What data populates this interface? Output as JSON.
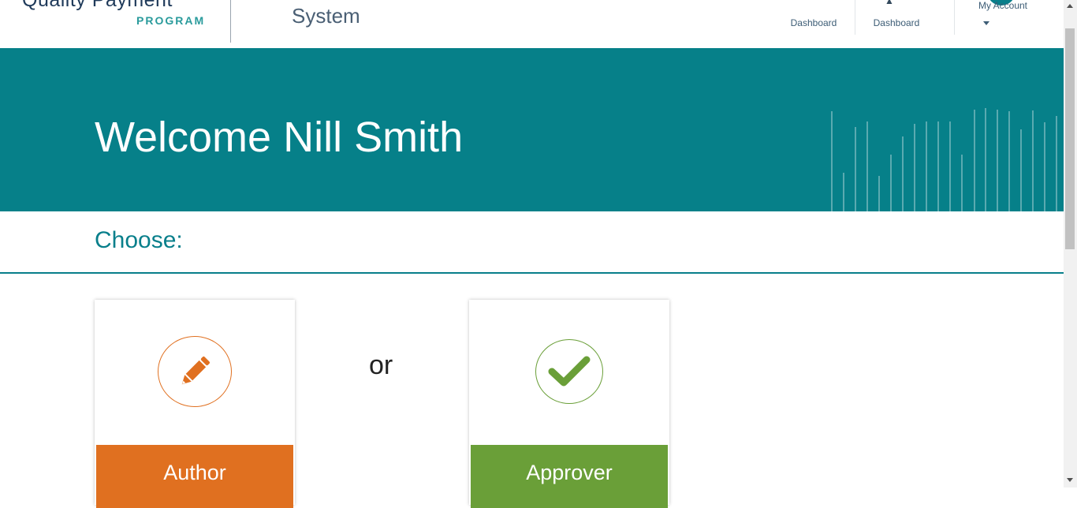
{
  "header": {
    "logo_line1": "Quality Payment",
    "logo_line2": "PROGRAM",
    "system_text": "System",
    "nav": [
      {
        "label": "Dashboard"
      },
      {
        "label": "Dashboard"
      },
      {
        "label": "My Account"
      }
    ]
  },
  "banner": {
    "welcome": "Welcome Nill Smith"
  },
  "main": {
    "choose_label": "Choose:",
    "or_text": "or",
    "cards": [
      {
        "label": "Author",
        "icon": "pencil-icon",
        "color": "#E07020"
      },
      {
        "label": "Approver",
        "icon": "checkmark-icon",
        "color": "#6A9F38"
      }
    ]
  },
  "colors": {
    "teal": "#068089",
    "navy": "#1F3A5A",
    "orange": "#E07020",
    "green": "#6A9F38"
  }
}
